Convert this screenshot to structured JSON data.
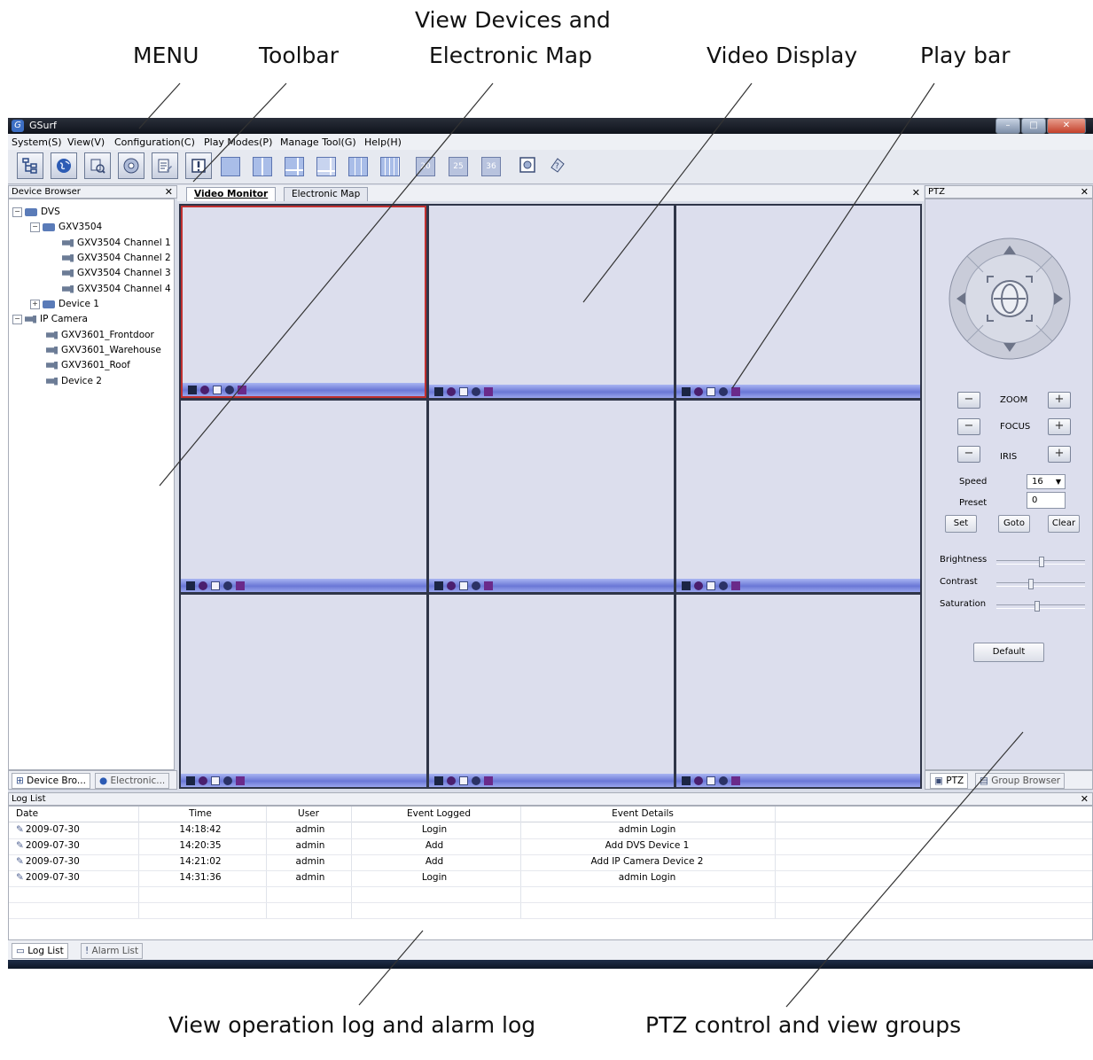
{
  "callouts": {
    "menu": "MENU",
    "toolbar": "Toolbar",
    "view_devices_line1": "View Devices and",
    "view_devices_line2": "Electronic Map",
    "video_display": "Video Display",
    "play_bar": "Play bar",
    "log": "View operation log and alarm log",
    "ptz": "PTZ control and view groups"
  },
  "window": {
    "title": "GSurf"
  },
  "menu": [
    "System(S)",
    "View(V)",
    "Configuration(C)",
    "Play Modes(P)",
    "Manage Tool(G)",
    "Help(H)"
  ],
  "toolbar": {
    "icons": [
      "device-tree-icon",
      "globe-icon",
      "search-device-icon",
      "ptz-icon",
      "config-icon",
      "alarm-icon"
    ],
    "layout_numbers": [
      "20",
      "25",
      "36"
    ]
  },
  "device_browser": {
    "title": "Device Browser",
    "tree": [
      "DVS",
      "GXV3504",
      "GXV3504 Channel 1",
      "GXV3504 Channel 2",
      "GXV3504 Channel 3",
      "GXV3504 Channel 4",
      "Device 1",
      "IP Camera",
      "GXV3601_Frontdoor",
      "GXV3601_Warehouse",
      "GXV3601_Roof",
      "Device 2"
    ],
    "tabs": [
      "Device Bro...",
      "Electronic..."
    ]
  },
  "video": {
    "tabs": [
      "Video Monitor",
      "Electronic Map"
    ]
  },
  "ptz": {
    "title": "PTZ",
    "zoom": "ZOOM",
    "focus": "FOCUS",
    "iris": "IRIS",
    "speed_label": "Speed",
    "speed_value": "16",
    "preset_label": "Preset",
    "preset_value": "0",
    "set": "Set",
    "goto": "Goto",
    "clear": "Clear",
    "brightness": "Brightness",
    "contrast": "Contrast",
    "saturation": "Saturation",
    "brightness_level": 0.5,
    "contrast_level": 0.38,
    "saturation_level": 0.45,
    "default": "Default",
    "tabs": [
      "PTZ",
      "Group Browser"
    ]
  },
  "log": {
    "title": "Log List",
    "columns": [
      "Date",
      "Time",
      "User",
      "Event Logged",
      "Event Details"
    ],
    "rows": [
      [
        "2009-07-30",
        "14:18:42",
        "admin",
        "Login",
        "admin Login"
      ],
      [
        "2009-07-30",
        "14:20:35",
        "admin",
        "Add",
        "Add  DVS Device 1"
      ],
      [
        "2009-07-30",
        "14:21:02",
        "admin",
        "Add",
        "Add  IP Camera Device 2"
      ],
      [
        "2009-07-30",
        "14:31:36",
        "admin",
        "Login",
        "admin Login"
      ]
    ],
    "tabs": [
      "Log List",
      "Alarm List"
    ]
  },
  "colors": {
    "selected_cell": "#c03030",
    "play_bar": "#7b88e0",
    "cell_bg": "#dcdeed"
  }
}
